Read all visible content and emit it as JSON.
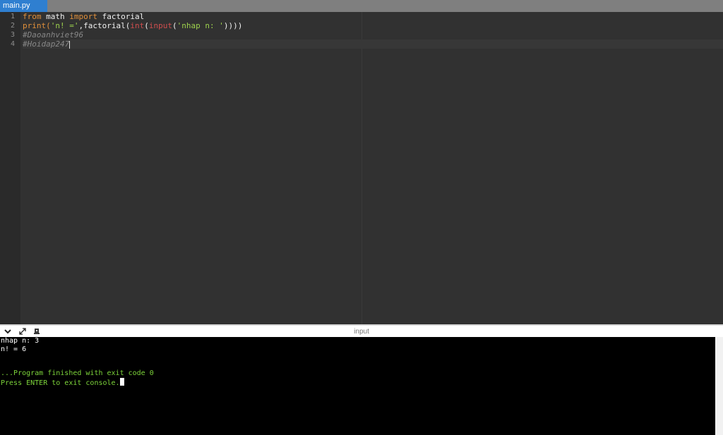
{
  "tabs": [
    {
      "label": "main.py"
    }
  ],
  "editor": {
    "line_numbers": [
      "1",
      "2",
      "3",
      "4"
    ],
    "line1": {
      "t1": "from",
      "t2": " math ",
      "t3": "import",
      "t4": " factorial"
    },
    "line2": {
      "t1": "print(",
      "t2": "'n! ='",
      "t3": ",factorial(",
      "t4": "int",
      "t5": "(",
      "t6": "input",
      "t7": "(",
      "t8": "'nhap n: '",
      "t9": "))))"
    },
    "line3": {
      "t1": "#Daoanhviet96"
    },
    "line4": {
      "t1": "#Hoidap247"
    }
  },
  "console": {
    "title": "input",
    "icons": [
      "chevron-down-icon",
      "expand-icon",
      "settings-icon"
    ],
    "lines": [
      "nhap n: 3",
      "n! = 6",
      "",
      "",
      "...Program finished with exit code 0",
      "Press ENTER to exit console."
    ]
  },
  "colors": {
    "keyword": "#e1903b",
    "string": "#9dd14d",
    "builtin": "#d04e4e",
    "comment": "#878787",
    "console_success": "#7cd33a",
    "tab_active": "#2f7fd0"
  }
}
